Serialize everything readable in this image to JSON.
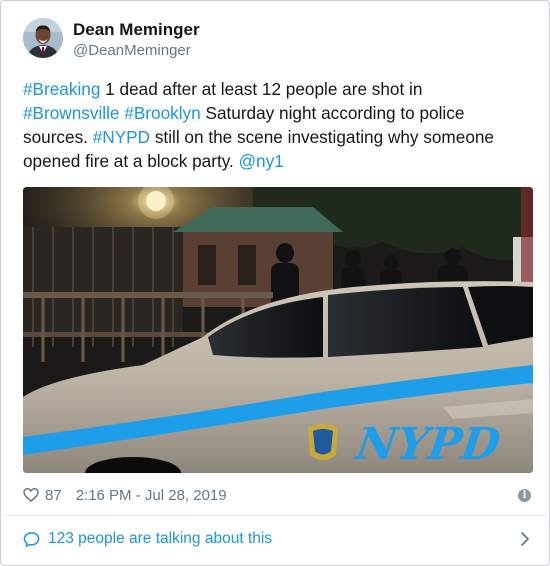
{
  "author": {
    "display_name": "Dean Meminger",
    "handle": "@DeanMeminger"
  },
  "tweet": {
    "hashtag_breaking": "#Breaking",
    "text_1": " 1 dead after at least 12 people are shot in ",
    "hashtag_brownsville": "#Brownsville",
    "hashtag_brooklyn": "#Brooklyn",
    "text_2": " Saturday night according to police sources. ",
    "hashtag_nypd": "#NYPD",
    "text_3": " still on the scene investigating why someone opened fire at a block party. ",
    "mention_ny1": "@ny1"
  },
  "media": {
    "car_lettering": "NYPD"
  },
  "meta": {
    "likes": "87",
    "timestamp": "2:16 PM - Jul 28, 2019"
  },
  "footer": {
    "conversation_label": "123 people are talking about this"
  },
  "colors": {
    "link": "#1b95e0",
    "secondary_text": "#657786",
    "nypd_blue": "#1e9ee8"
  },
  "icons": [
    "heart-icon",
    "info-icon",
    "speech-bubble-icon",
    "chevron-right-icon"
  ]
}
